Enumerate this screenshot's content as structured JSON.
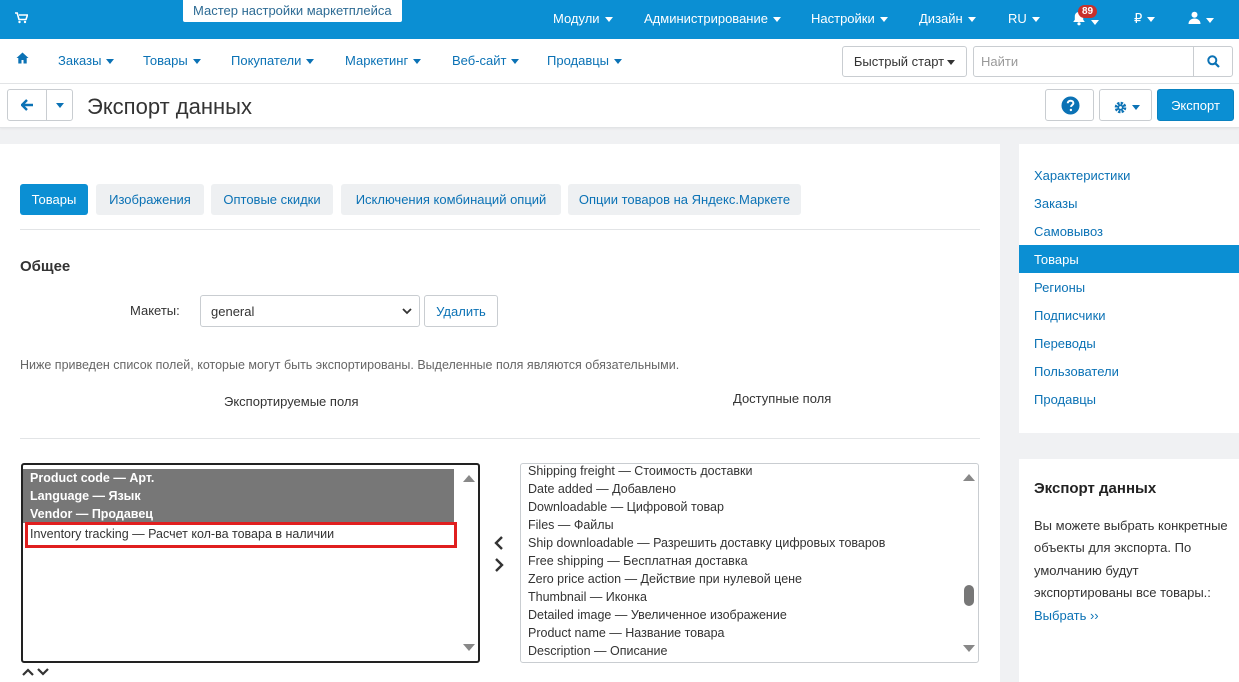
{
  "topbar": {
    "wizard_label": "Мастер настройки маркетплейса",
    "menu": [
      "Модули",
      "Администрирование",
      "Настройки",
      "Дизайн",
      "RU"
    ],
    "notifications_count": "89",
    "currency": "₽"
  },
  "navbar": {
    "items": [
      "Заказы",
      "Товары",
      "Покупатели",
      "Маркетинг",
      "Веб-сайт",
      "Продавцы"
    ],
    "quick_start": "Быстрый старт",
    "search_placeholder": "Найти"
  },
  "toolbar": {
    "title": "Экспорт данных",
    "export_label": "Экспорт"
  },
  "tabs": [
    {
      "label": "Товары",
      "active": true
    },
    {
      "label": "Изображения",
      "active": false
    },
    {
      "label": "Оптовые скидки",
      "active": false
    },
    {
      "label": "Исключения комбинаций опций",
      "active": false
    },
    {
      "label": "Опции товаров на Яндекс.Маркете",
      "active": false
    }
  ],
  "general": {
    "heading": "Общее",
    "layouts_label": "Макеты:",
    "layout_value": "general",
    "delete_label": "Удалить",
    "note": "Ниже приведен список полей, которые могут быть экспортированы. Выделенные поля являются обязательными.",
    "exported_heading": "Экспортируемые поля",
    "available_heading": "Доступные поля"
  },
  "exported_fields": [
    {
      "label": "Product code — Арт.",
      "required": true
    },
    {
      "label": "Language — Язык",
      "required": true
    },
    {
      "label": "Vendor — Продавец",
      "required": true
    },
    {
      "label": "Inventory tracking — Расчет кол-ва товара в наличии",
      "required": false,
      "highlighted": true
    }
  ],
  "available_fields": [
    "Shipping freight — Стоимость доставки",
    "Date added — Добавлено",
    "Downloadable — Цифровой товар",
    "Files — Файлы",
    "Ship downloadable — Разрешить доставку цифровых товаров",
    "Free shipping — Бесплатная доставка",
    "Zero price action — Действие при нулевой цене",
    "Thumbnail — Иконка",
    "Detailed image — Увеличенное изображение",
    "Product name — Название товара",
    "Description — Описание"
  ],
  "sidebar": {
    "items": [
      {
        "label": "Характеристики",
        "active": false
      },
      {
        "label": "Заказы",
        "active": false
      },
      {
        "label": "Самовывоз",
        "active": false
      },
      {
        "label": "Товары",
        "active": true
      },
      {
        "label": "Регионы",
        "active": false
      },
      {
        "label": "Подписчики",
        "active": false
      },
      {
        "label": "Переводы",
        "active": false
      },
      {
        "label": "Пользователи",
        "active": false
      },
      {
        "label": "Продавцы",
        "active": false
      }
    ],
    "info_title": "Экспорт данных",
    "info_text": "Вы можете выбрать конкретные объекты для экспорта. По умолчанию будут экспортированы все товары.:",
    "info_link": "Выбрать ››"
  },
  "colors": {
    "primary": "#0b8fd3",
    "link": "#0b72b5",
    "highlight": "#e01f1f",
    "required_bg": "#777777",
    "badge": "#c7312b"
  }
}
